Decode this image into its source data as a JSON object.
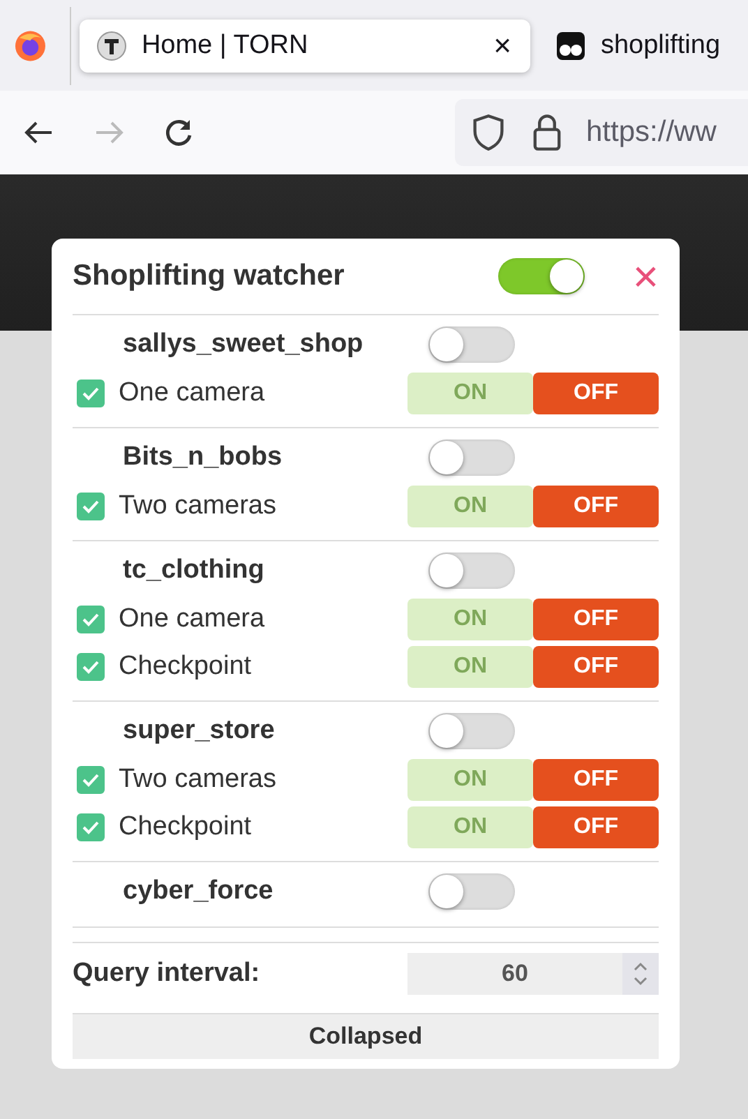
{
  "browser": {
    "tabs": [
      {
        "title": "Home | TORN",
        "selected": true,
        "close": "×"
      },
      {
        "title": "shoplifting",
        "selected": false
      }
    ],
    "nav": {
      "back_disabled": false,
      "forward_disabled": true
    },
    "address": "https://ww"
  },
  "panel": {
    "title": "Shoplifting watcher",
    "enabled": true,
    "close": "×",
    "shops": [
      {
        "name": "sallys_sweet_shop",
        "enabled": false,
        "options": [
          {
            "label": "One camera",
            "checked": true,
            "buttons": [
              {
                "label": "ON",
                "selected": false
              },
              {
                "label": "OFF",
                "selected": true
              }
            ]
          }
        ]
      },
      {
        "name": "Bits_n_bobs",
        "enabled": false,
        "options": [
          {
            "label": "Two cameras",
            "checked": true,
            "buttons": [
              {
                "label": "ON",
                "selected": false
              },
              {
                "label": "OFF",
                "selected": true
              }
            ]
          }
        ]
      },
      {
        "name": "tc_clothing",
        "enabled": false,
        "options": [
          {
            "label": "One camera",
            "checked": true,
            "buttons": [
              {
                "label": "ON",
                "selected": false
              },
              {
                "label": "OFF",
                "selected": true
              }
            ]
          },
          {
            "label": "Checkpoint",
            "checked": true,
            "buttons": [
              {
                "label": "ON",
                "selected": false
              },
              {
                "label": "OFF",
                "selected": true
              }
            ]
          }
        ]
      },
      {
        "name": "super_store",
        "enabled": false,
        "options": [
          {
            "label": "Two cameras",
            "checked": true,
            "buttons": [
              {
                "label": "ON",
                "selected": false
              },
              {
                "label": "OFF",
                "selected": true
              }
            ]
          },
          {
            "label": "Checkpoint",
            "checked": true,
            "buttons": [
              {
                "label": "ON",
                "selected": false
              },
              {
                "label": "OFF",
                "selected": true
              }
            ]
          }
        ]
      },
      {
        "name": "cyber_force",
        "enabled": false
      }
    ],
    "query_label": "Query interval:",
    "query_value": "60",
    "footer_button": "Collapsed"
  }
}
